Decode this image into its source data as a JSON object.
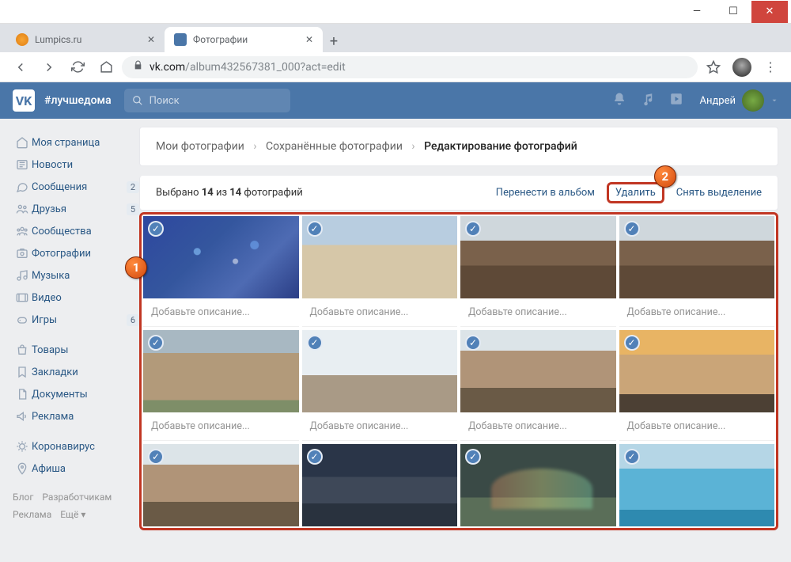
{
  "window": {
    "min": "—",
    "max": "☐",
    "close": "✕"
  },
  "tabs": [
    {
      "title": "Lumpics.ru",
      "active": false
    },
    {
      "title": "Фотографии",
      "active": true
    }
  ],
  "url": {
    "host": "vk.com",
    "path": "/album432567381_000?act=edit"
  },
  "vk": {
    "logo": "VK",
    "hashtag": "#лучшедома",
    "search": "Поиск",
    "user": "Андрей"
  },
  "sidebar": {
    "items": [
      {
        "icon": "home",
        "label": "Моя страница"
      },
      {
        "icon": "news",
        "label": "Новости"
      },
      {
        "icon": "msg",
        "label": "Сообщения",
        "badge": "2"
      },
      {
        "icon": "friends",
        "label": "Друзья",
        "badge": "5"
      },
      {
        "icon": "groups",
        "label": "Сообщества"
      },
      {
        "icon": "photo",
        "label": "Фотографии"
      },
      {
        "icon": "music",
        "label": "Музыка"
      },
      {
        "icon": "video",
        "label": "Видео"
      },
      {
        "icon": "games",
        "label": "Игры",
        "badge": "6"
      }
    ],
    "items2": [
      {
        "icon": "market",
        "label": "Товары"
      },
      {
        "icon": "bookmark",
        "label": "Закладки"
      },
      {
        "icon": "docs",
        "label": "Документы"
      },
      {
        "icon": "ads",
        "label": "Реклама"
      }
    ],
    "items3": [
      {
        "icon": "virus",
        "label": "Коронавирус"
      },
      {
        "icon": "event",
        "label": "Афиша"
      }
    ],
    "footer": [
      "Блог",
      "Разработчикам",
      "Реклама",
      "Ещё ▾"
    ]
  },
  "breadcrumbs": {
    "a": "Мои фотографии",
    "b": "Сохранённые фотографии",
    "c": "Редактирование фотографий"
  },
  "selection": {
    "prefix": "Выбрано ",
    "n": "14",
    "mid": " из ",
    "total": "14",
    "suffix": " фотографий",
    "move": "Перенести в альбом",
    "del": "Удалить",
    "clear": "Снять выделение"
  },
  "desc_placeholder": "Добавьте описание...",
  "callouts": {
    "one": "1",
    "two": "2"
  },
  "thumbs": [
    "t-abstract",
    "t-city",
    "t-cliff",
    "t-cliff",
    "t-aerial",
    "t-fog",
    "t-bridge",
    "t-sunset",
    "t-bridge",
    "t-night",
    "t-rainbow",
    "t-sea"
  ]
}
